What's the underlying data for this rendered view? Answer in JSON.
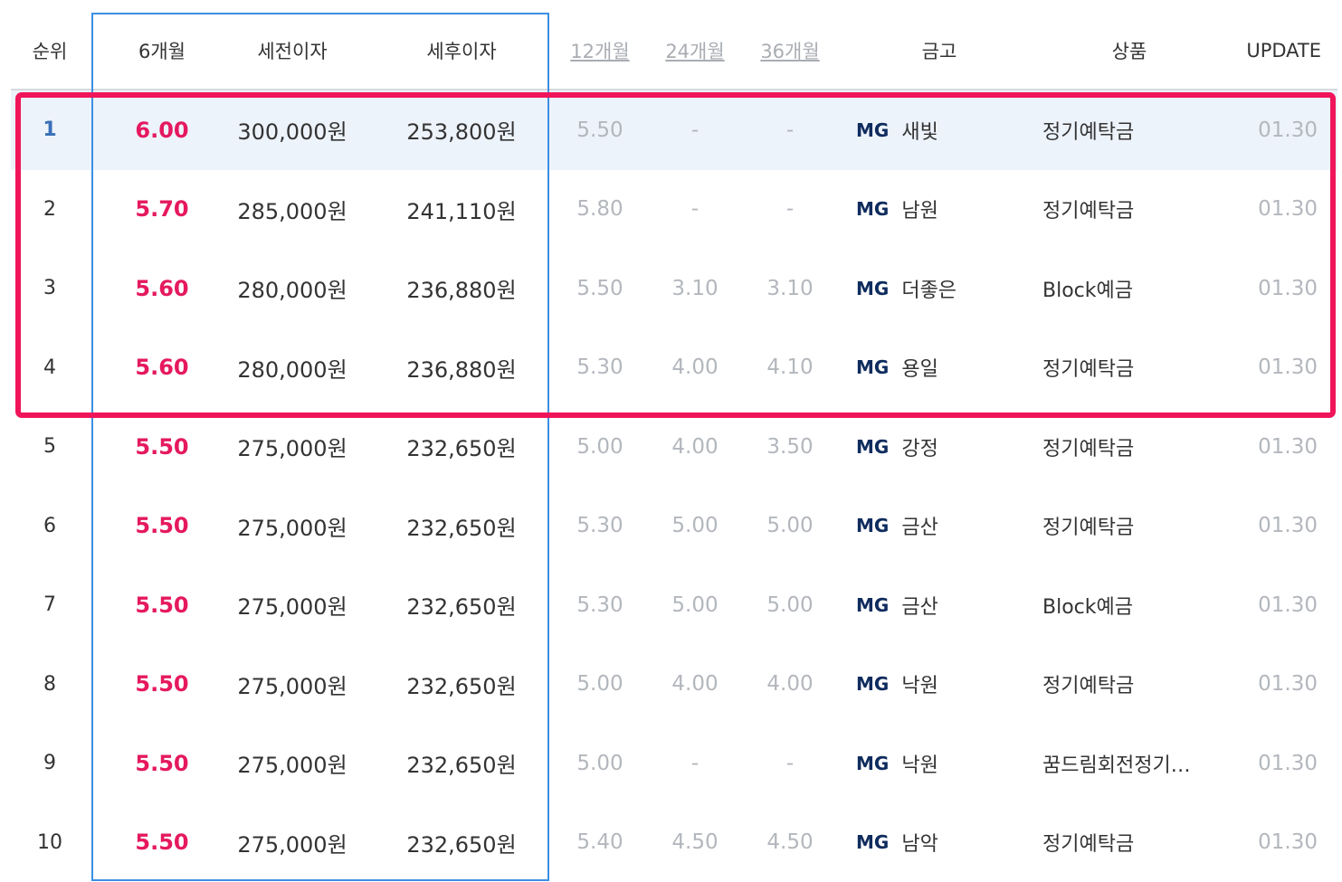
{
  "columns": {
    "rank": "순위",
    "m6": "6개월",
    "pretax": "세전이자",
    "posttax": "세후이자",
    "m12": "12개월",
    "m24": "24개월",
    "m36": "36개월",
    "bank": "금고",
    "product": "상품",
    "update": "UPDATE"
  },
  "rows": [
    {
      "rank": "1",
      "m6": "6.00",
      "pretax": "300,000원",
      "posttax": "253,800원",
      "m12": "5.50",
      "m24": "-",
      "m36": "-",
      "bank_prefix": "MG",
      "bank": "새빛",
      "product": "정기예탁금",
      "update": "01.30"
    },
    {
      "rank": "2",
      "m6": "5.70",
      "pretax": "285,000원",
      "posttax": "241,110원",
      "m12": "5.80",
      "m24": "-",
      "m36": "-",
      "bank_prefix": "MG",
      "bank": "남원",
      "product": "정기예탁금",
      "update": "01.30"
    },
    {
      "rank": "3",
      "m6": "5.60",
      "pretax": "280,000원",
      "posttax": "236,880원",
      "m12": "5.50",
      "m24": "3.10",
      "m36": "3.10",
      "bank_prefix": "MG",
      "bank": "더좋은",
      "product": "Block예금",
      "update": "01.30"
    },
    {
      "rank": "4",
      "m6": "5.60",
      "pretax": "280,000원",
      "posttax": "236,880원",
      "m12": "5.30",
      "m24": "4.00",
      "m36": "4.10",
      "bank_prefix": "MG",
      "bank": "용일",
      "product": "정기예탁금",
      "update": "01.30"
    },
    {
      "rank": "5",
      "m6": "5.50",
      "pretax": "275,000원",
      "posttax": "232,650원",
      "m12": "5.00",
      "m24": "4.00",
      "m36": "3.50",
      "bank_prefix": "MG",
      "bank": "강정",
      "product": "정기예탁금",
      "update": "01.30"
    },
    {
      "rank": "6",
      "m6": "5.50",
      "pretax": "275,000원",
      "posttax": "232,650원",
      "m12": "5.30",
      "m24": "5.00",
      "m36": "5.00",
      "bank_prefix": "MG",
      "bank": "금산",
      "product": "정기예탁금",
      "update": "01.30"
    },
    {
      "rank": "7",
      "m6": "5.50",
      "pretax": "275,000원",
      "posttax": "232,650원",
      "m12": "5.30",
      "m24": "5.00",
      "m36": "5.00",
      "bank_prefix": "MG",
      "bank": "금산",
      "product": "Block예금",
      "update": "01.30"
    },
    {
      "rank": "8",
      "m6": "5.50",
      "pretax": "275,000원",
      "posttax": "232,650원",
      "m12": "5.00",
      "m24": "4.00",
      "m36": "4.00",
      "bank_prefix": "MG",
      "bank": "낙원",
      "product": "정기예탁금",
      "update": "01.30"
    },
    {
      "rank": "9",
      "m6": "5.50",
      "pretax": "275,000원",
      "posttax": "232,650원",
      "m12": "5.00",
      "m24": "-",
      "m36": "-",
      "bank_prefix": "MG",
      "bank": "낙원",
      "product": "꿈드림회전정기…",
      "update": "01.30"
    },
    {
      "rank": "10",
      "m6": "5.50",
      "pretax": "275,000원",
      "posttax": "232,650원",
      "m12": "5.40",
      "m24": "4.50",
      "m36": "4.50",
      "bank_prefix": "MG",
      "bank": "남악",
      "product": "정기예탁금",
      "update": "01.30"
    }
  ],
  "colors": {
    "rate_accent": "#e5195f",
    "muted_text": "#b3b7bd",
    "mg_brand": "#0f2c5e",
    "highlight_row": "#edf3fb",
    "blue_outline": "#3d8fe3",
    "red_outline": "#f0155a"
  }
}
